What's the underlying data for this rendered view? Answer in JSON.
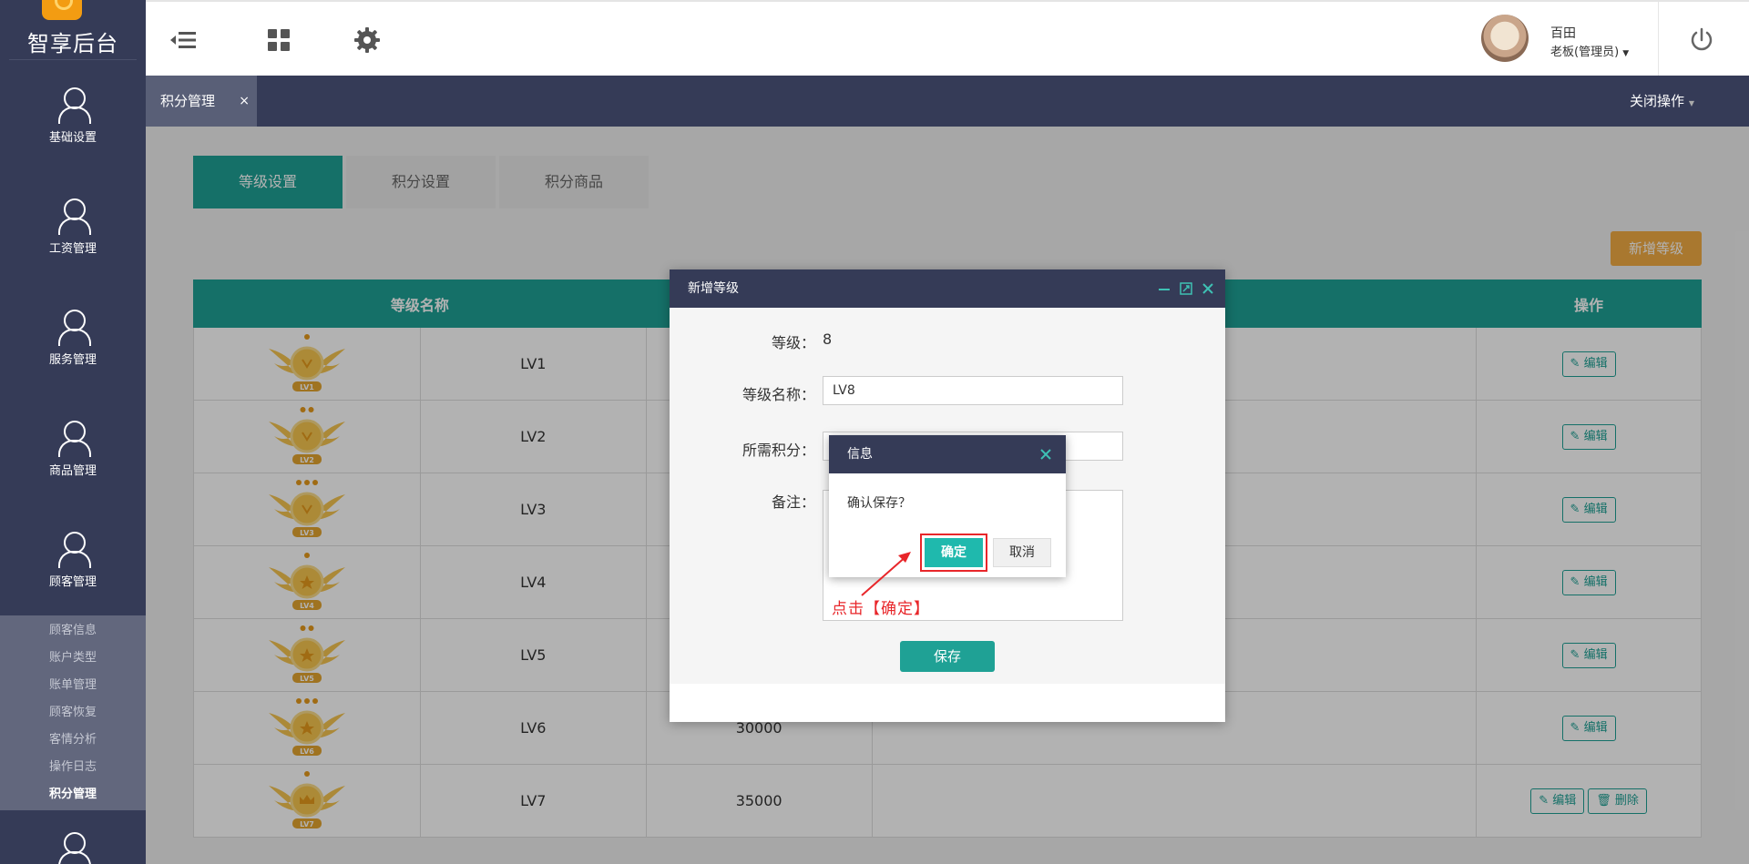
{
  "sidebar": {
    "logo_text": "智享后台",
    "nav": [
      {
        "label": "基础设置"
      },
      {
        "label": "工资管理"
      },
      {
        "label": "服务管理"
      },
      {
        "label": "商品管理"
      },
      {
        "label": "顾客管理"
      }
    ],
    "submenu": [
      "顾客信息",
      "账户类型",
      "账单管理",
      "顾客恢复",
      "客情分析",
      "操作日志",
      "积分管理"
    ]
  },
  "header": {
    "user_name": "百田",
    "user_role": "老板(管理员)",
    "icons": [
      "menu-collapse-icon",
      "grid-icon",
      "gear-icon",
      "power-icon"
    ]
  },
  "tabbar": {
    "open_tab": "积分管理",
    "close_symbol": "×",
    "close_ops": "关闭操作"
  },
  "page_tabs": [
    "等级设置",
    "积分设置",
    "积分商品"
  ],
  "add_level": "新增等级",
  "table": {
    "headers": [
      "等级名称",
      "操作"
    ],
    "edit_label": "编辑",
    "delete_label": "删除",
    "rows": [
      {
        "badge": "LV1",
        "name": "LV1",
        "points": ""
      },
      {
        "badge": "LV2",
        "name": "LV2",
        "points": ""
      },
      {
        "badge": "LV3",
        "name": "LV3",
        "points": ""
      },
      {
        "badge": "LV4",
        "name": "LV4",
        "points": ""
      },
      {
        "badge": "LV5",
        "name": "LV5",
        "points": ""
      },
      {
        "badge": "LV6",
        "name": "LV6",
        "points": "30000"
      },
      {
        "badge": "LV7",
        "name": "LV7",
        "points": "35000"
      }
    ]
  },
  "modal": {
    "title": "新增等级",
    "level_label": "等级：",
    "level_value": "8",
    "name_label": "等级名称：",
    "name_value": "LV8",
    "points_label": "所需积分：",
    "remark_label": "备注：",
    "save": "保存"
  },
  "confirm": {
    "title": "信息",
    "message": "确认保存？",
    "ok": "确定",
    "cancel": "取消"
  },
  "annotation": "点击【确定】",
  "colors": {
    "sidebar": "#353b57",
    "accent": "#1fa195",
    "orange": "#f2ac44",
    "highlight": "#e8262a"
  }
}
